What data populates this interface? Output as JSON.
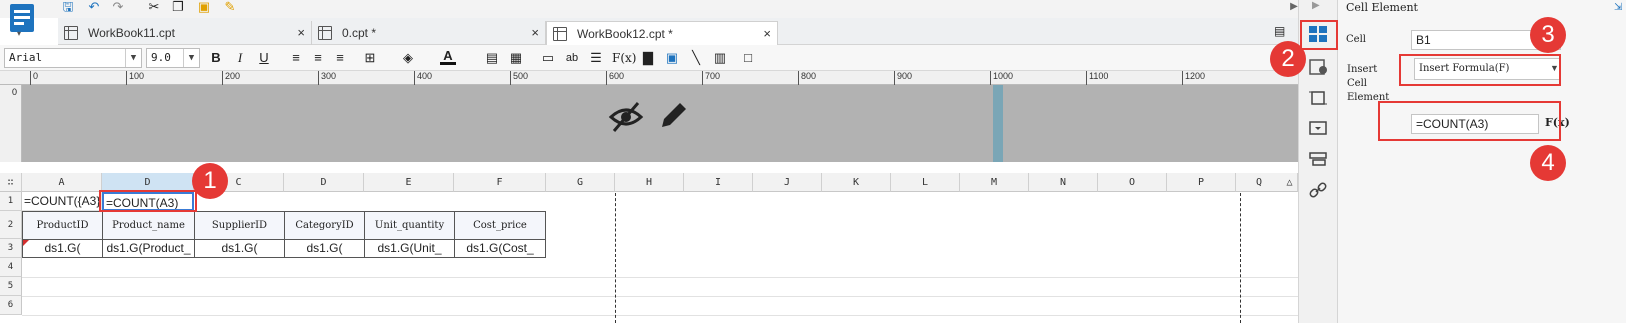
{
  "tabs": [
    {
      "label": "WorkBook11.cpt"
    },
    {
      "label": "0.cpt *"
    },
    {
      "label": "WorkBook12.cpt *"
    }
  ],
  "format_toolbar": {
    "font_name": "Arial",
    "font_size": "9.0"
  },
  "ruler": {
    "ticks": [
      "0",
      "100",
      "200",
      "300",
      "400",
      "500",
      "600",
      "700",
      "800",
      "900",
      "1000",
      "1100",
      "1200"
    ]
  },
  "vruler_label": "0",
  "grid": {
    "columns": [
      "A",
      "D",
      "C",
      "D",
      "E",
      "F",
      "G",
      "H",
      "I",
      "J",
      "K",
      "L",
      "M",
      "N",
      "O",
      "P",
      "Q"
    ],
    "row_labels": [
      "1 (H)",
      "2 (H)",
      "3",
      "4",
      "5",
      "6"
    ],
    "row1": {
      "a": "=COUNT({A3}",
      "b": "=COUNT(A3)"
    },
    "headers": [
      "ProductID",
      "Product_name",
      "SupplierID",
      "CategoryID",
      "Unit_quantity",
      "Cost_price"
    ],
    "data": [
      "ds1.G(",
      "ds1.G(Product_",
      "ds1.G(",
      "ds1.G(",
      "ds1.G(Unit_",
      "ds1.G(Cost_"
    ]
  },
  "panel": {
    "title": "Cell Element",
    "cell_label": "Cell",
    "cell_value": "B1",
    "insert_label_1": "Insert",
    "insert_label_2": "Cell",
    "insert_label_3": "Element",
    "insert_value": "Insert Formula(F)",
    "formula_value": "=COUNT(A3)",
    "formula_button": "F(x)"
  },
  "callouts": [
    "1",
    "2",
    "3",
    "4"
  ],
  "colors": {
    "accent": "#e53935",
    "selected_icon": "#1e73be",
    "band": "#b2b2b2"
  }
}
